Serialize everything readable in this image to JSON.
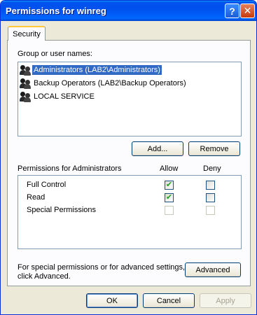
{
  "window": {
    "title": "Permissions for winreg"
  },
  "titlebar": {
    "help_glyph": "?",
    "close_glyph": "✕"
  },
  "tabs": [
    {
      "label": "Security",
      "active": true
    }
  ],
  "users": {
    "label": "Group or user names:",
    "items": [
      {
        "name": "Administrators (LAB2\\Administrators)",
        "selected": true
      },
      {
        "name": "Backup Operators (LAB2\\Backup Operators)",
        "selected": false
      },
      {
        "name": "LOCAL SERVICE",
        "selected": false
      }
    ],
    "add_label": "Add...",
    "remove_label": "Remove"
  },
  "permissions": {
    "header": "Permissions for Administrators",
    "allow_header": "Allow",
    "deny_header": "Deny",
    "rows": [
      {
        "name": "Full Control",
        "allow": true,
        "deny": false,
        "enabled": true
      },
      {
        "name": "Read",
        "allow": true,
        "deny": false,
        "enabled": true
      },
      {
        "name": "Special Permissions",
        "allow": false,
        "deny": false,
        "enabled": false
      }
    ]
  },
  "advanced": {
    "note": "For special permissions or for advanced settings, click Advanced.",
    "note_line1": "For special permissions or for advanced settings,",
    "note_line2": "click Advanced.",
    "button_label": "Advanced"
  },
  "footer": {
    "ok_label": "OK",
    "cancel_label": "Cancel",
    "apply_label": "Apply",
    "apply_enabled": false
  },
  "colors": {
    "titlebar": "#0054e3",
    "selection": "#316ac5",
    "dialog_bg": "#ece9d8",
    "check": "#21a121"
  }
}
